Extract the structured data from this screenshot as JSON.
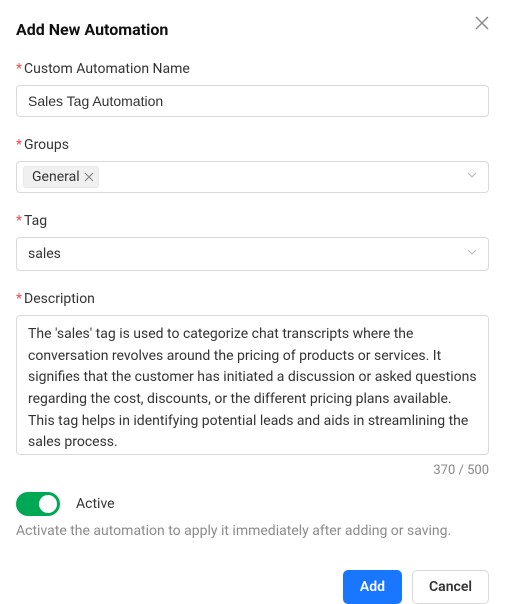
{
  "header": {
    "title": "Add New Automation"
  },
  "fields": {
    "name": {
      "label": "Custom Automation Name",
      "value": "Sales Tag Automation"
    },
    "groups": {
      "label": "Groups",
      "selected": [
        "General"
      ]
    },
    "tag": {
      "label": "Tag",
      "value": "sales"
    },
    "description": {
      "label": "Description",
      "value": "The 'sales' tag is used to categorize chat transcripts where the conversation revolves around the pricing of products or services. It signifies that the customer has initiated a discussion or asked questions regarding the cost, discounts, or the different pricing plans available. This tag helps in identifying potential leads and aids in streamlining the sales process.",
      "count": "370 / 500"
    }
  },
  "active": {
    "label": "Active",
    "on": true,
    "help": "Activate the automation to apply it immediately after adding or saving."
  },
  "buttons": {
    "add": "Add",
    "cancel": "Cancel"
  }
}
